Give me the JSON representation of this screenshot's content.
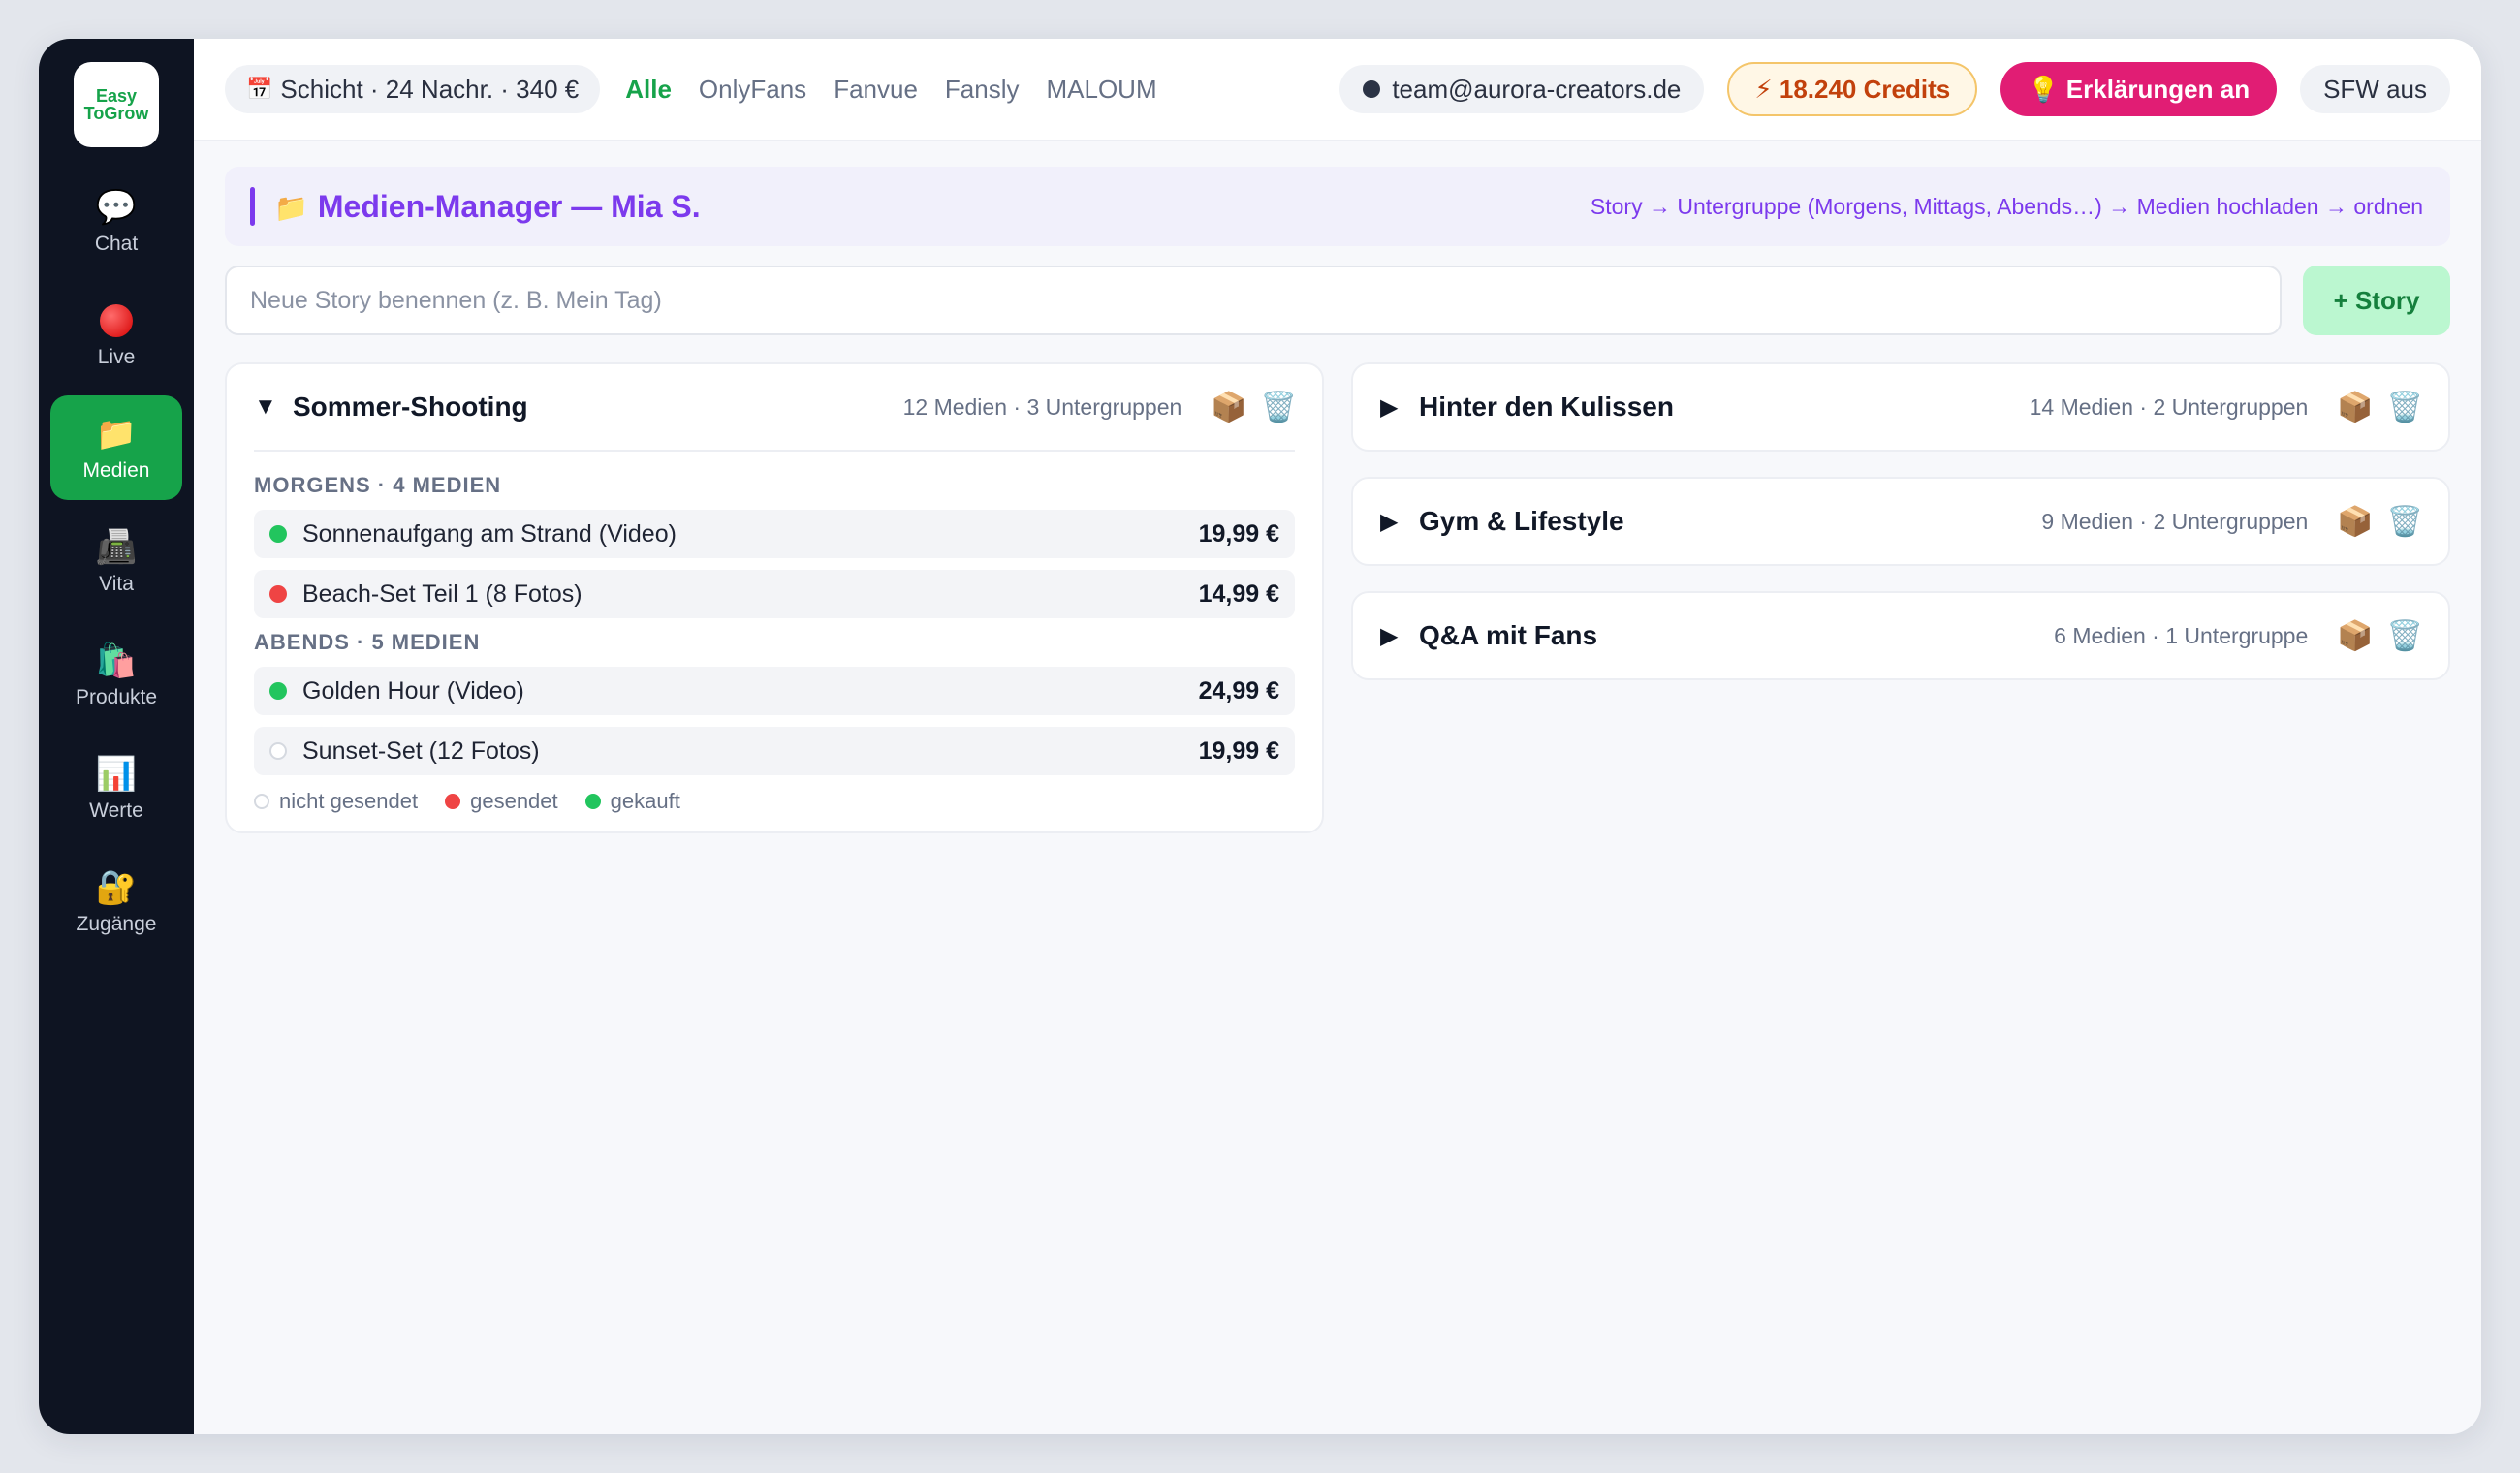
{
  "sidebar": {
    "logo_line1": "Easy",
    "logo_line2": "ToGrow",
    "items": [
      {
        "label": "Chat",
        "icon": "💬"
      },
      {
        "label": "Live",
        "icon": ""
      },
      {
        "label": "Medien",
        "icon": "📁"
      },
      {
        "label": "Vita",
        "icon": "📠"
      },
      {
        "label": "Produkte",
        "icon": "🛍️"
      },
      {
        "label": "Werte",
        "icon": "📊"
      },
      {
        "label": "Zugänge",
        "icon": "🔐"
      }
    ]
  },
  "topbar": {
    "shift_icon": "📅",
    "shift": "Schicht · 24 Nachr. · 340 €",
    "platforms": [
      "Alle",
      "OnlyFans",
      "Fanvue",
      "Fansly",
      "MALOUM"
    ],
    "email": "team@aurora-creators.de",
    "credits": "⚡ 18.240 Credits",
    "explain": "💡 Erklärungen an",
    "sfw": "SFW aus"
  },
  "header": {
    "icon": "📁",
    "title": "Medien-Manager — Mia S.",
    "hint": "Story → Untergruppe (Morgens, Mittags, Abends…) → Medien hochladen → ordnen"
  },
  "story_input": {
    "placeholder": "Neue Story benennen (z. B. Mein Tag)",
    "value": "",
    "button": "+ Story"
  },
  "icons": {
    "box": "📦",
    "trash": "🗑️",
    "expanded": "▼",
    "collapsed": "▶"
  },
  "colors": {
    "accent_green": "#16a34a",
    "accent_purple": "#7c3aed",
    "accent_pink": "#e11d74",
    "sidebar_bg": "#0e1422"
  },
  "open_story": {
    "title": "Sommer-Shooting",
    "meta": "12 Medien · 3 Untergruppen",
    "groups": [
      {
        "label": "MORGENS · 4 MEDIEN",
        "items": [
          {
            "name": "Sonnenaufgang am Strand (Video)",
            "price": "19,99 €",
            "status": "gekauft"
          },
          {
            "name": "Beach-Set Teil 1 (8 Fotos)",
            "price": "14,99 €",
            "status": "gesendet"
          }
        ]
      },
      {
        "label": "ABENDS · 5 MEDIEN",
        "items": [
          {
            "name": "Golden Hour (Video)",
            "price": "24,99 €",
            "status": "gekauft"
          },
          {
            "name": "Sunset-Set (12 Fotos)",
            "price": "19,99 €",
            "status": "nicht"
          }
        ]
      }
    ],
    "legend": [
      "nicht gesendet",
      "gesendet",
      "gekauft"
    ]
  },
  "stories": [
    {
      "title": "Hinter den Kulissen",
      "meta": "14 Medien · 2 Untergruppen"
    },
    {
      "title": "Gym & Lifestyle",
      "meta": "9 Medien · 2 Untergruppen"
    },
    {
      "title": "Q&A mit Fans",
      "meta": "6 Medien · 1 Untergruppe"
    }
  ]
}
